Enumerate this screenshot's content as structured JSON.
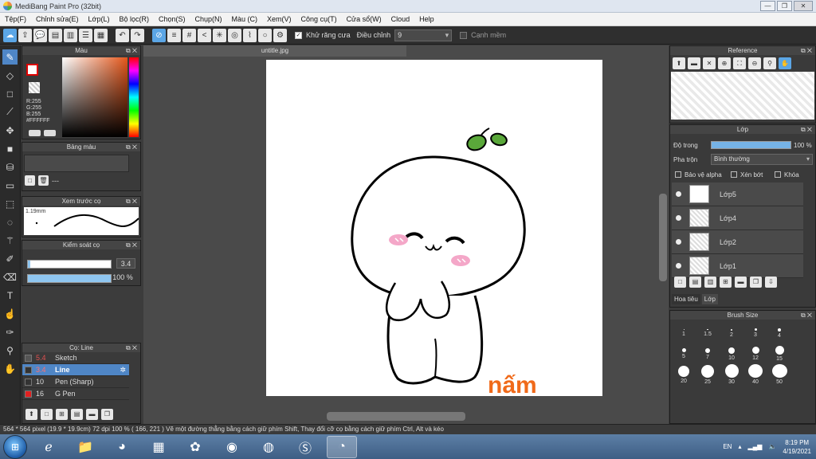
{
  "window": {
    "title": "MediBang Paint Pro (32bit)"
  },
  "menu": [
    "Tệp(F)",
    "Chỉnh sửa(E)",
    "Lớp(L)",
    "Bộ lọc(R)",
    "Chọn(S)",
    "Chụp(N)",
    "Màu (C)",
    "Xem(V)",
    "Công cụ(T)",
    "Cửa sổ(W)",
    "Cloud",
    "Help"
  ],
  "toolbar": {
    "antialias_label": "Khử răng cưa",
    "correction_label": "Điều chỉnh",
    "correction_value": "9",
    "smooth_label": "Cạnh mềm"
  },
  "color_panel": {
    "title": "Màu",
    "r": "R:255",
    "g": "G:255",
    "b": "B:255",
    "hex": "#FFFFFF"
  },
  "palette_panel": {
    "title": "Bảng màu",
    "dash": "---"
  },
  "preview_panel": {
    "title": "Xem trước cọ",
    "size": "1.19mm"
  },
  "control_panel": {
    "title": "Kiểm soát cọ",
    "size_value": "3.4",
    "opacity_value": "100 %"
  },
  "brush_panel": {
    "title": "Cọ: Line",
    "items": [
      {
        "size": "5.4",
        "name": "Sketch",
        "color": "#555555"
      },
      {
        "size": "3.4",
        "name": "Line",
        "color": "#333333"
      },
      {
        "size": "10",
        "name": "Pen (Sharp)",
        "color": "#333333"
      },
      {
        "size": "16",
        "name": "G Pen",
        "color": "#e02020"
      }
    ]
  },
  "canvas": {
    "tab": "untitle.jpg",
    "signature": "nấm"
  },
  "reference_panel": {
    "title": "Reference"
  },
  "layer_panel": {
    "title": "Lớp",
    "opacity_label": "Độ trong",
    "opacity_value": "100 %",
    "blend_label": "Pha trộn",
    "blend_value": "Bình thường",
    "protect_alpha": "Bảo vệ alpha",
    "clip": "Xén bớt",
    "lock": "Khóa",
    "layers": [
      "Lớp5",
      "Lớp4",
      "Lớp2",
      "Lớp1"
    ],
    "tabs": [
      "Hoa tiêu",
      "Lớp"
    ]
  },
  "brush_size_panel": {
    "title": "Brush Size",
    "sizes": [
      "1",
      "1.5",
      "2",
      "3",
      "4",
      "5",
      "7",
      "10",
      "12",
      "15",
      "20",
      "25",
      "30",
      "40",
      "50"
    ]
  },
  "status": "564 * 564 pixel   (19.9 * 19.9cm)   72 dpi   100 %   ( 166, 221 )   Vẽ một đường thẳng bằng cách giữ phím Shift, Thay đổi cỡ cọ bằng cách giữ phím Ctrl, Alt và kéo",
  "taskbar": {
    "lang": "EN",
    "time": "8:19 PM",
    "date": "4/19/2021"
  }
}
